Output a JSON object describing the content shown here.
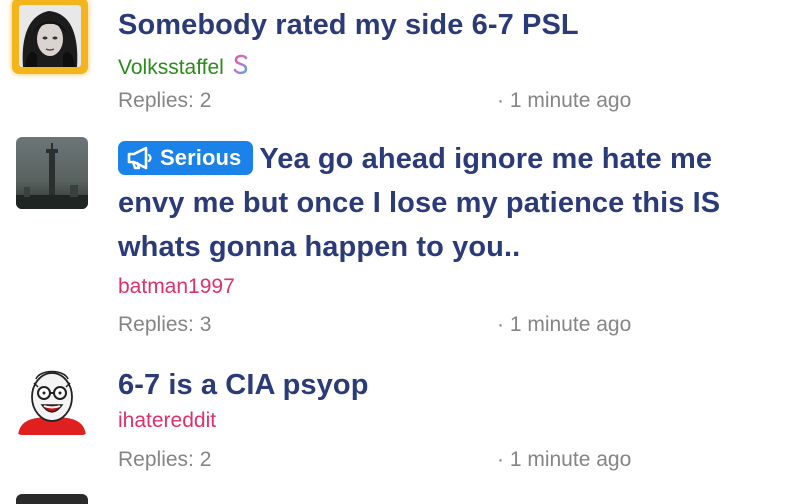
{
  "threads": [
    {
      "title": "Somebody rated my side 6-7 PSL",
      "author": "Volksstaffel",
      "author_color": "#2a8a1a",
      "author_badge_icon": "dollar-icon",
      "replies": "Replies: 2",
      "time": "· 1 minute ago",
      "avatar": "gold-framed-avatar"
    },
    {
      "badge": {
        "icon": "megaphone-icon",
        "label": "Serious",
        "color": "#1a82e8"
      },
      "title": "Yea go ahead ignore me hate me envy me but once I lose my patience this IS whats gonna happen to you..",
      "author": "batman1997",
      "author_color": "#e0306a",
      "replies": "Replies: 3",
      "time": "· 1 minute ago",
      "avatar": "foggy-tower-avatar"
    },
    {
      "title": "6-7 is a CIA psyop",
      "author": "ihatereddit",
      "author_color": "#e0306a",
      "replies": "Replies: 2",
      "time": "· 1 minute ago",
      "avatar": "cartoon-face-avatar"
    }
  ],
  "colors": {
    "title": "#2b3b7a",
    "meta": "#858585",
    "avatar_frame": "#f4b51c"
  }
}
